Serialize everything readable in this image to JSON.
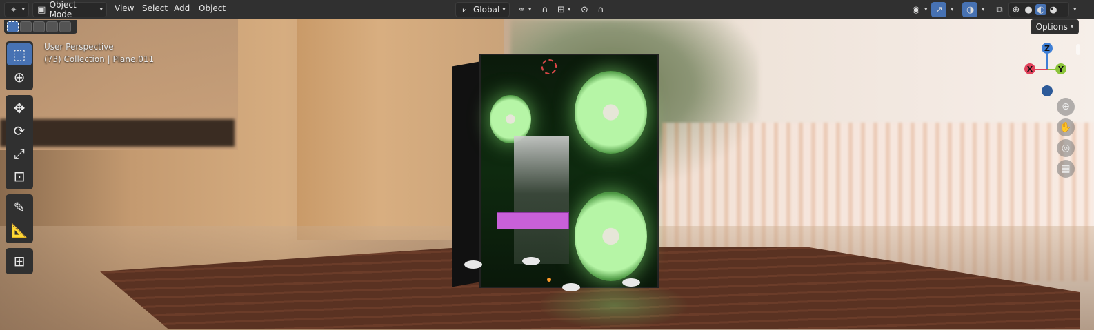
{
  "header": {
    "mode": "Object Mode",
    "menus": [
      "View",
      "Select",
      "Add",
      "Object"
    ],
    "transform_orientation": "Global"
  },
  "viewport": {
    "perspective_label": "User Perspective",
    "collection_label": "(73) Collection | Plane.011",
    "options_label": "Options"
  },
  "gizmo": {
    "x": "X",
    "y": "Y",
    "z": "Z"
  },
  "icons": {
    "editor_type": "editor-type-icon",
    "mode": "object-mode-icon",
    "orientation": "transform-orientation-icon",
    "pivot": "pivot-point-icon",
    "snap": "snap-magnet-icon",
    "proportional": "proportional-editing-icon",
    "falloff": "falloff-curve-icon",
    "visibility": "visibility-eye-icon",
    "gizmo": "gizmo-icon",
    "overlays": "overlays-icon",
    "xray": "xray-icon"
  },
  "colors": {
    "accent": "#4772b3",
    "header_bg": "#303030",
    "axis_x": "#e0415a",
    "axis_y": "#8cc43a",
    "axis_z": "#3e7fd6"
  }
}
